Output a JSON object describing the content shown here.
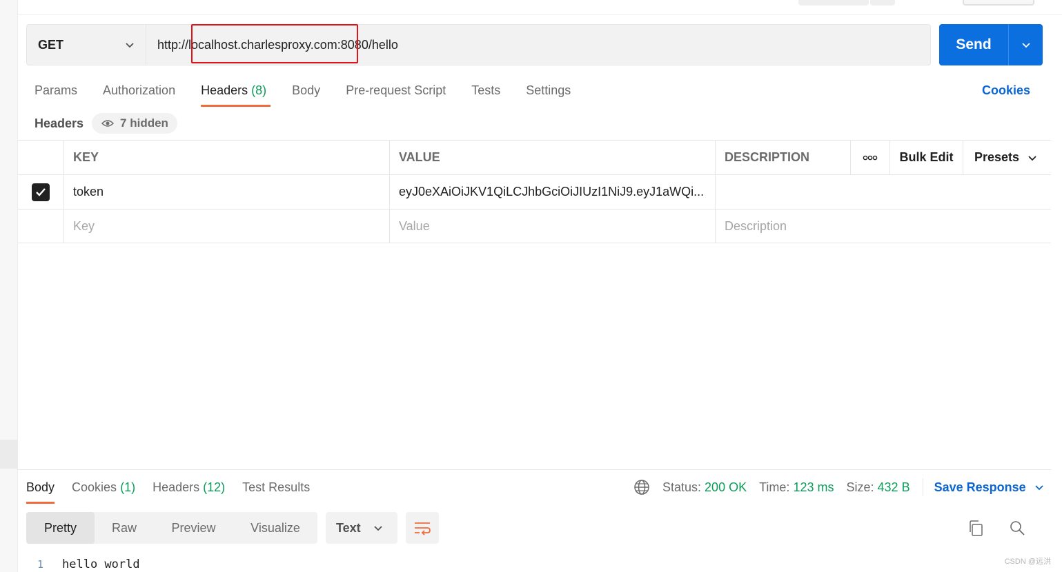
{
  "request": {
    "method": "GET",
    "url": "http://localhost.charlesproxy.com:8080/hello",
    "send_label": "Send"
  },
  "request_tabs": [
    {
      "label": "Params"
    },
    {
      "label": "Authorization"
    },
    {
      "label": "Headers",
      "count": "(8)"
    },
    {
      "label": "Body"
    },
    {
      "label": "Pre-request Script"
    },
    {
      "label": "Tests"
    },
    {
      "label": "Settings"
    }
  ],
  "cookies_label": "Cookies",
  "headers_section": {
    "title": "Headers",
    "hidden_label": "7 hidden"
  },
  "table": {
    "columns": {
      "key": "KEY",
      "value": "VALUE",
      "description": "DESCRIPTION"
    },
    "bulk_edit": "Bulk Edit",
    "presets": "Presets",
    "rows": [
      {
        "key": "token",
        "value": "eyJ0eXAiOiJKV1QiLCJhbGciOiJIUzI1NiJ9.eyJ1aWQi...",
        "description": ""
      }
    ],
    "placeholders": {
      "key": "Key",
      "value": "Value",
      "description": "Description"
    }
  },
  "response_tabs": [
    {
      "label": "Body"
    },
    {
      "label": "Cookies",
      "count": "(1)"
    },
    {
      "label": "Headers",
      "count": "(12)"
    },
    {
      "label": "Test Results"
    }
  ],
  "response_meta": {
    "status_label": "Status:",
    "status_value": "200 OK",
    "time_label": "Time:",
    "time_value": "123 ms",
    "size_label": "Size:",
    "size_value": "432 B",
    "save_label": "Save Response"
  },
  "format_buttons": [
    {
      "label": "Pretty"
    },
    {
      "label": "Raw"
    },
    {
      "label": "Preview"
    },
    {
      "label": "Visualize"
    }
  ],
  "language": "Text",
  "code_lines": [
    {
      "n": "1",
      "text": "hello world"
    }
  ],
  "watermark": "CSDN @远洪",
  "colors": {
    "accent_blue": "#0c6fe0",
    "tab_underline": "#f26b3a",
    "success_green": "#0a9d58",
    "highlight_red": "#e0121a"
  }
}
